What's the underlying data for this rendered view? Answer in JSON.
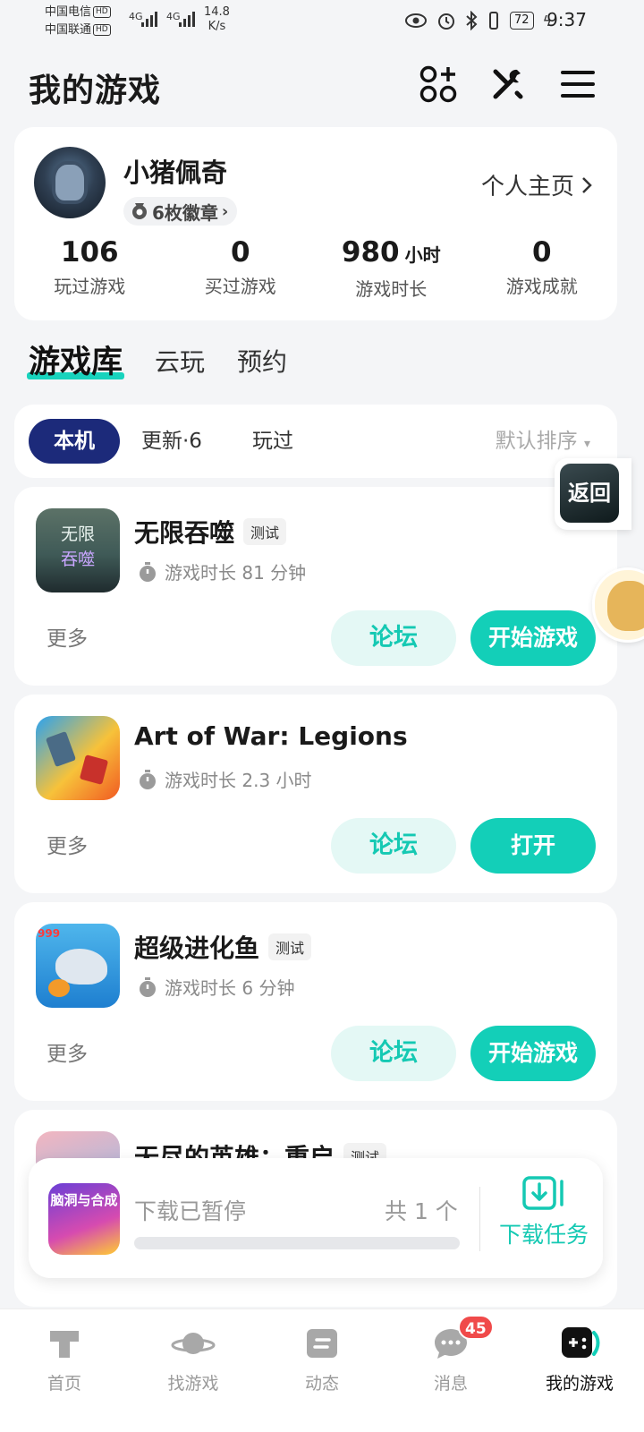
{
  "status_bar": {
    "carrier_1": "中国电信",
    "carrier_2": "中国联通",
    "hd": "HD",
    "network": "4G",
    "speed_value": "14.8",
    "speed_unit": "K/s",
    "battery": "72",
    "time": "9:37"
  },
  "header": {
    "title": "我的游戏",
    "icons": [
      "apps-add-icon",
      "tools-icon",
      "menu-icon"
    ]
  },
  "profile": {
    "name": "小猪佩奇",
    "badges": "6枚徽章",
    "home_link": "个人主页",
    "stats": [
      {
        "value": "106",
        "unit": "",
        "label": "玩过游戏"
      },
      {
        "value": "0",
        "unit": "",
        "label": "买过游戏"
      },
      {
        "value": "980",
        "unit": "小时",
        "label": "游戏时长"
      },
      {
        "value": "0",
        "unit": "",
        "label": "游戏成就"
      }
    ]
  },
  "section_tabs": [
    "游戏库",
    "云玩",
    "预约"
  ],
  "filters": {
    "chips": [
      "本机",
      "更新·6",
      "玩过"
    ],
    "sort": "默认排序"
  },
  "games": [
    {
      "title": "无限吞噬",
      "tag": "测试",
      "playtime": "游戏时长 81 分钟",
      "more": "更多",
      "forum": "论坛",
      "action": "开始游戏",
      "icon_text_1": "无限",
      "icon_text_2": "吞噬"
    },
    {
      "title": "Art of War: Legions",
      "tag": "",
      "playtime": "游戏时长 2.3 小时",
      "more": "更多",
      "forum": "论坛",
      "action": "打开"
    },
    {
      "title": "超级进化鱼",
      "tag": "测试",
      "playtime": "游戏时长 6 分钟",
      "more": "更多",
      "forum": "论坛",
      "action": "开始游戏",
      "icon_badge": "999"
    },
    {
      "title": "无尽的英雄：重启",
      "tag": "测试"
    }
  ],
  "floating": {
    "back_label": "返回"
  },
  "download": {
    "icon_text": "脑洞与合成",
    "status": "下载已暂停",
    "count": "共 1 个",
    "task_label": "下载任务",
    "progress": 0
  },
  "bottom_nav": [
    {
      "label": "首页",
      "icon": "home-icon"
    },
    {
      "label": "找游戏",
      "icon": "planet-icon"
    },
    {
      "label": "动态",
      "icon": "feed-icon"
    },
    {
      "label": "消息",
      "icon": "message-icon",
      "badge": "45"
    },
    {
      "label": "我的游戏",
      "icon": "gamepad-icon",
      "active": true
    }
  ],
  "colors": {
    "accent": "#13cfb8",
    "active_chip": "#1c2a7a",
    "badge": "#f04a4a"
  }
}
